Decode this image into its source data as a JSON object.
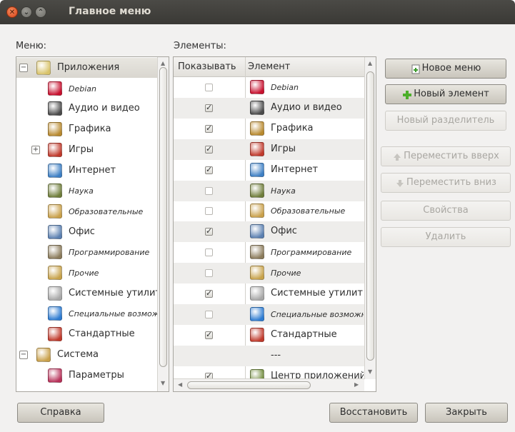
{
  "window": {
    "title": "Главное меню"
  },
  "labels": {
    "menu": "Меню:",
    "elements": "Элементы:"
  },
  "tree": {
    "items": [
      {
        "label": "Приложения",
        "icon": "applications-icon",
        "level": 0,
        "expander": "−",
        "selected": true,
        "italic": false,
        "color": "#d9c36a"
      },
      {
        "label": "Debian",
        "icon": "debian-swirl-icon",
        "level": 1,
        "italic": true,
        "color": "#c8102e"
      },
      {
        "label": "Аудио и видео",
        "icon": "audio-video-icon",
        "level": 1,
        "italic": false,
        "color": "#4a4a4a"
      },
      {
        "label": "Графика",
        "icon": "graphics-icon",
        "level": 1,
        "italic": false,
        "color": "#b8892e"
      },
      {
        "label": "Игры",
        "icon": "games-cards-icon",
        "level": 1,
        "expander": "+",
        "italic": false,
        "color": "#c0392b"
      },
      {
        "label": "Интернет",
        "icon": "internet-globe-icon",
        "level": 1,
        "italic": false,
        "color": "#3d7fc4"
      },
      {
        "label": "Наука",
        "icon": "science-icon",
        "level": 1,
        "italic": true,
        "color": "#6f7d3a"
      },
      {
        "label": "Образовательные",
        "icon": "education-icon",
        "level": 1,
        "italic": true,
        "color": "#c9a04a"
      },
      {
        "label": "Офис",
        "icon": "office-icon",
        "level": 1,
        "italic": false,
        "color": "#5a7fb0"
      },
      {
        "label": "Программирование",
        "icon": "programming-icon",
        "level": 1,
        "italic": true,
        "color": "#8a7a5a"
      },
      {
        "label": "Прочие",
        "icon": "other-icon",
        "level": 1,
        "italic": true,
        "color": "#c7a24a"
      },
      {
        "label": "Системные утилиты",
        "icon": "system-tools-gear-icon",
        "level": 1,
        "italic": false,
        "color": "#a8a8a8"
      },
      {
        "label": "Специальные возможности",
        "icon": "accessibility-icon",
        "level": 1,
        "italic": true,
        "color": "#2d7bd1"
      },
      {
        "label": "Стандартные",
        "icon": "accessories-icon",
        "level": 1,
        "italic": false,
        "color": "#c0392b"
      },
      {
        "label": "Система",
        "icon": "system-icon",
        "level": 0,
        "expander": "−",
        "italic": false,
        "color": "#c9a04a"
      },
      {
        "label": "Параметры",
        "icon": "preferences-icon",
        "level": 1,
        "italic": false,
        "color": "#b8325a"
      }
    ]
  },
  "table": {
    "headers": {
      "show": "Показывать",
      "item": "Элемент"
    },
    "rows": [
      {
        "label": "Debian",
        "checked": false,
        "italic": true,
        "icon": "debian-swirl-icon",
        "color": "#c8102e"
      },
      {
        "label": "Аудио и видео",
        "checked": true,
        "italic": false,
        "icon": "audio-video-icon",
        "color": "#4a4a4a"
      },
      {
        "label": "Графика",
        "checked": true,
        "italic": false,
        "icon": "graphics-icon",
        "color": "#b8892e"
      },
      {
        "label": "Игры",
        "checked": true,
        "italic": false,
        "icon": "games-cards-icon",
        "color": "#c0392b"
      },
      {
        "label": "Интернет",
        "checked": true,
        "italic": false,
        "icon": "internet-globe-icon",
        "color": "#3d7fc4"
      },
      {
        "label": "Наука",
        "checked": false,
        "italic": true,
        "icon": "science-icon",
        "color": "#6f7d3a"
      },
      {
        "label": "Образовательные",
        "checked": false,
        "italic": true,
        "icon": "education-icon",
        "color": "#c9a04a"
      },
      {
        "label": "Офис",
        "checked": true,
        "italic": false,
        "icon": "office-icon",
        "color": "#5a7fb0"
      },
      {
        "label": "Программирование",
        "checked": false,
        "italic": true,
        "icon": "programming-icon",
        "color": "#8a7a5a"
      },
      {
        "label": "Прочие",
        "checked": false,
        "italic": true,
        "icon": "other-icon",
        "color": "#c7a24a"
      },
      {
        "label": "Системные утилиты",
        "checked": true,
        "italic": false,
        "icon": "system-tools-gear-icon",
        "color": "#a8a8a8"
      },
      {
        "label": "Специальные возможности",
        "checked": false,
        "italic": true,
        "icon": "accessibility-icon",
        "color": "#2d7bd1"
      },
      {
        "label": "Стандартные",
        "checked": true,
        "italic": false,
        "icon": "accessories-icon",
        "color": "#c0392b"
      },
      {
        "label": "---",
        "separator": true
      },
      {
        "label": "Центр приложений",
        "checked": true,
        "italic": false,
        "icon": "software-center-icon",
        "color": "#6f8a3a"
      }
    ]
  },
  "buttons": {
    "new_menu": "Новое меню",
    "new_item": "Новый элемент",
    "new_separator": "Новый разделитель",
    "move_up": "Переместить вверх",
    "move_down": "Переместить вниз",
    "properties": "Свойства",
    "delete": "Удалить",
    "help": "Справка",
    "revert": "Восстановить",
    "close": "Закрыть"
  },
  "colors": {
    "titlebar": "#3c3b37",
    "accent_close": "#df4a16"
  }
}
